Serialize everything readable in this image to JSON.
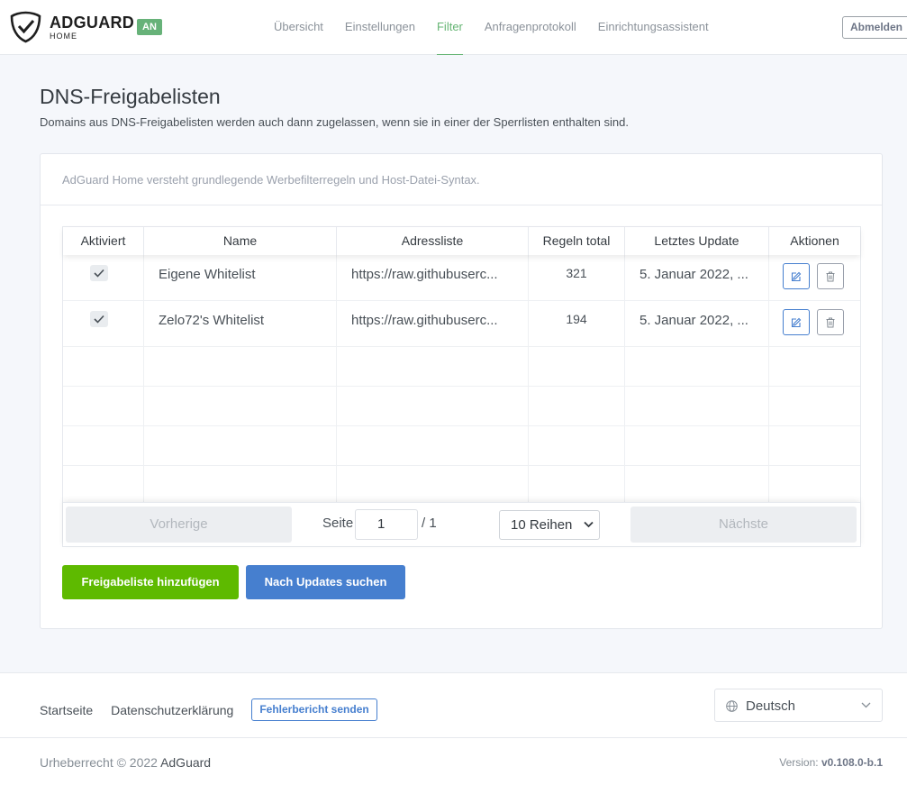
{
  "header": {
    "brand_name": "ADGUARD",
    "brand_sub": "HOME",
    "status_badge": "AN",
    "nav": [
      {
        "label": "Übersicht",
        "active": false
      },
      {
        "label": "Einstellungen",
        "active": false
      },
      {
        "label": "Filter",
        "active": true
      },
      {
        "label": "Anfragenprotokoll",
        "active": false
      },
      {
        "label": "Einrichtungsassistent",
        "active": false
      }
    ],
    "logout_label": "Abmelden"
  },
  "page": {
    "title": "DNS-Freigabelisten",
    "description": "Domains aus DNS-Freigabelisten werden auch dann zugelassen, wenn sie in einer der Sperrlisten enthalten sind."
  },
  "card": {
    "hint": "AdGuard Home versteht grundlegende Werbefilterregeln und Host-Datei-Syntax."
  },
  "table": {
    "columns": [
      "Aktiviert",
      "Name",
      "Adressliste",
      "Regeln total",
      "Letztes Update",
      "Aktionen"
    ],
    "rows": [
      {
        "enabled": true,
        "name": "Eigene Whitelist",
        "url": "https://raw.githubuserc...",
        "rules": "321",
        "updated": "5. Januar 2022, ..."
      },
      {
        "enabled": true,
        "name": "Zelo72's Whitelist",
        "url": "https://raw.githubuserc...",
        "rules": "194",
        "updated": "5. Januar 2022, ..."
      }
    ]
  },
  "pagination": {
    "prev_label": "Vorherige",
    "page_label": "Seite",
    "current_page": "1",
    "total_pages": "/ 1",
    "rows_per_page": "10 Reihen",
    "next_label": "Nächste"
  },
  "actions": {
    "add_label": "Freigabeliste hinzufügen",
    "update_label": "Nach Updates suchen"
  },
  "footer": {
    "links": [
      "Startseite",
      "Datenschutzerklärung"
    ],
    "report_label": "Fehlerbericht senden",
    "language": "Deutsch",
    "copyright_prefix": "Urheberrecht © 2022 ",
    "copyright_brand": "AdGuard",
    "version_label": "Version: ",
    "version_value": "v0.108.0-b.1"
  },
  "colors": {
    "accent_green": "#5eba00",
    "nav_active": "#66b574",
    "primary_blue": "#467fcf",
    "badge_green": "#67b279"
  }
}
